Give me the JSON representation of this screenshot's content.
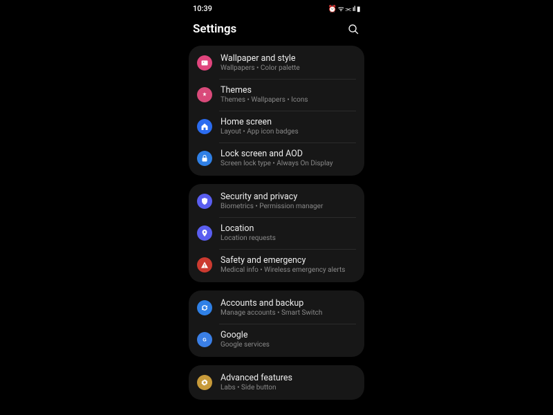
{
  "status": {
    "time": "10:39",
    "icons": "⏰ ᯤ ⫘ ıl ▮"
  },
  "header": {
    "title": "Settings"
  },
  "groups": [
    {
      "id": "display",
      "items": [
        {
          "id": "wallpaper",
          "title": "Wallpaper and style",
          "sub": "Wallpapers • Color palette",
          "color": "#e0457d",
          "icon": "image"
        },
        {
          "id": "themes",
          "title": "Themes",
          "sub": "Themes • Wallpapers • Icons",
          "color": "#d94a7a",
          "icon": "brush"
        },
        {
          "id": "home-screen",
          "title": "Home screen",
          "sub": "Layout • App icon badges",
          "color": "#2b6cf0",
          "icon": "home"
        },
        {
          "id": "lock-screen",
          "title": "Lock screen and AOD",
          "sub": "Screen lock type • Always On Display",
          "color": "#2f80e6",
          "icon": "lock"
        }
      ]
    },
    {
      "id": "security",
      "items": [
        {
          "id": "security-privacy",
          "title": "Security and privacy",
          "sub": "Biometrics • Permission manager",
          "color": "#5a5ef0",
          "icon": "shield"
        },
        {
          "id": "location",
          "title": "Location",
          "sub": "Location requests",
          "color": "#5a5ef0",
          "icon": "pin"
        },
        {
          "id": "safety",
          "title": "Safety and emergency",
          "sub": "Medical info • Wireless emergency alerts",
          "color": "#cc3a30",
          "icon": "alert"
        }
      ]
    },
    {
      "id": "accounts",
      "items": [
        {
          "id": "accounts-backup",
          "title": "Accounts and backup",
          "sub": "Manage accounts • Smart Switch",
          "color": "#2f80e6",
          "icon": "sync"
        },
        {
          "id": "google",
          "title": "Google",
          "sub": "Google services",
          "color": "#3a7fe6",
          "icon": "google"
        }
      ]
    },
    {
      "id": "advanced",
      "items": [
        {
          "id": "advanced-features",
          "title": "Advanced features",
          "sub": "Labs • Side button",
          "color": "#c79a3a",
          "icon": "gear"
        }
      ]
    }
  ]
}
